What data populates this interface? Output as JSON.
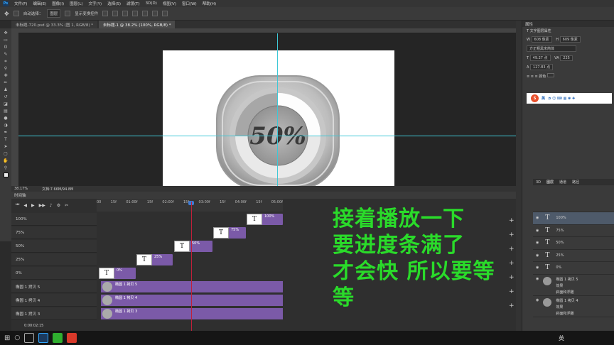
{
  "app": {
    "logo": "Ps"
  },
  "menu": [
    "文件(F)",
    "编辑(E)",
    "图像(I)",
    "图层(L)",
    "文字(Y)",
    "选择(S)",
    "滤镜(T)",
    "3D(D)",
    "视图(V)",
    "窗口(W)",
    "帮助(H)"
  ],
  "options": {
    "auto_select": "自动选择：",
    "auto_select_value": "图层",
    "show_transform": "显示变换控件"
  },
  "tabs": [
    "未标题-720.psd @ 33.3% (图 1, RGB/8) *",
    "未标题-1 @ 38.2% (100%, RGB/8) *"
  ],
  "canvas": {
    "label": "50%"
  },
  "status": {
    "zoom": "38.17%",
    "doc": "文档:7.66M/94.8M"
  },
  "properties": {
    "title": "属性",
    "subtitle": "文字图层属性",
    "w": "608 像素",
    "h": "609 像素",
    "font": "方正粗黑宋简体",
    "size": "49.27 点",
    "tracking": "225",
    "leading": "127.83 点",
    "color_label": "颜色"
  },
  "ime": {
    "label": "英"
  },
  "layers_panel": {
    "tabs": [
      "3D",
      "图层",
      "通道",
      "路径"
    ],
    "rows": [
      {
        "name": "100%",
        "type": "text",
        "selected": true
      },
      {
        "name": "75%",
        "type": "text",
        "selected": false
      },
      {
        "name": "50%",
        "type": "text",
        "selected": false
      },
      {
        "name": "25%",
        "type": "text",
        "selected": false
      },
      {
        "name": "0%",
        "type": "text",
        "selected": false
      },
      {
        "name": "椭圆 1 拷贝 5",
        "type": "shape",
        "fx": "效果",
        "fx2": "斜面和浮雕",
        "selected": false
      },
      {
        "name": "椭圆 1 拷贝 4",
        "type": "shape",
        "fx": "效果",
        "fx2": "斜面和浮雕",
        "selected": false
      }
    ]
  },
  "timeline": {
    "title": "时间轴",
    "ticks": [
      "00",
      "15f",
      "01:00f",
      "15f",
      "02:00f",
      "15f",
      "03:00f",
      "15f",
      "04:00f",
      "15f",
      "05:00f"
    ],
    "tracks": [
      "100%",
      "75%",
      "50%",
      "25%",
      "0%",
      "椭圆 1 拷贝 5",
      "椭圆 1 拷贝 4",
      "椭圆 1 拷贝 3"
    ],
    "clips": [
      {
        "label": "100%"
      },
      {
        "label": "75%"
      },
      {
        "label": "50%"
      },
      {
        "label": "25%"
      },
      {
        "label": "0%"
      }
    ],
    "shape_clips": [
      "椭圆 1 拷贝 5",
      "椭圆 1 拷贝 4",
      "椭圆 1 拷贝 3"
    ],
    "time": "0:00:02:15"
  },
  "overlay": {
    "line1": "接着播放一下",
    "line2": "要进度条满了",
    "line3": "才会快  所以要等等"
  },
  "taskbar": {
    "ime": "英"
  }
}
